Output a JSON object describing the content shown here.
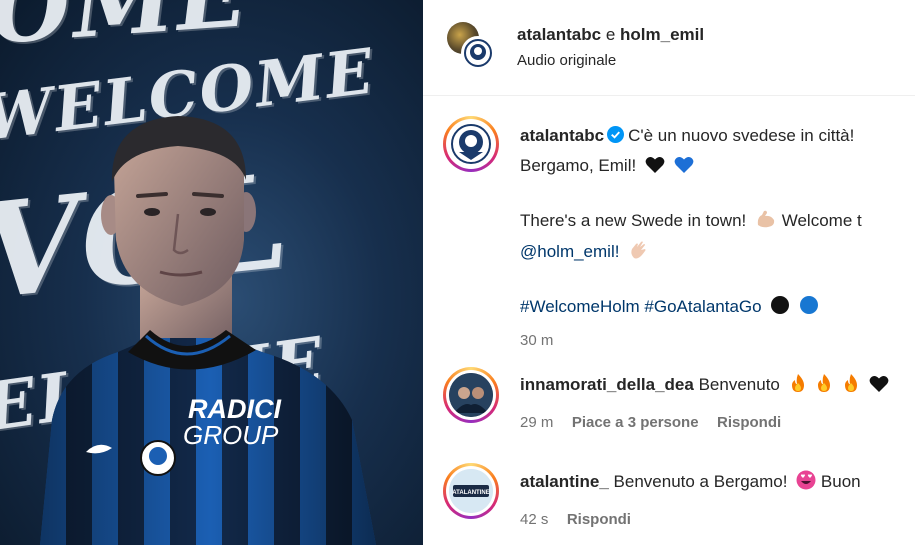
{
  "media": {
    "bg_words": [
      "OME",
      "WELCOME",
      "VOL",
      "ELCOME",
      "L"
    ],
    "sponsor_line1": "RADICI",
    "sponsor_line2": "GROUP"
  },
  "header": {
    "user1": "atalantabc",
    "joiner": "e",
    "user2": "holm_emil",
    "audio": "Audio originale"
  },
  "caption": {
    "username": "atalantabc",
    "line1": "C'è un nuovo svedese in città!",
    "line2": "Bergamo, Emil!",
    "line3": "There's a new Swede in town!",
    "line3b": "Welcome t",
    "mention": "@holm_emil!",
    "hashtag1": "#WelcomeHolm",
    "hashtag2": "#GoAtalantaGo",
    "time": "30 m"
  },
  "comments": [
    {
      "username": "innamorati_della_dea",
      "text": "Benvenuto",
      "time": "29 m",
      "likes": "Piace a 3 persone",
      "reply": "Rispondi"
    },
    {
      "username": "atalantine_",
      "text": "Benvenuto a Bergamo!",
      "text2": "Buon",
      "badge": "ATALANTINE",
      "time": "42 s",
      "reply": "Rispondi"
    }
  ],
  "colors": {
    "link": "#00376b",
    "verified": "#0095f6",
    "meta": "#737373",
    "jersey_blue": "#1b5fb3"
  }
}
